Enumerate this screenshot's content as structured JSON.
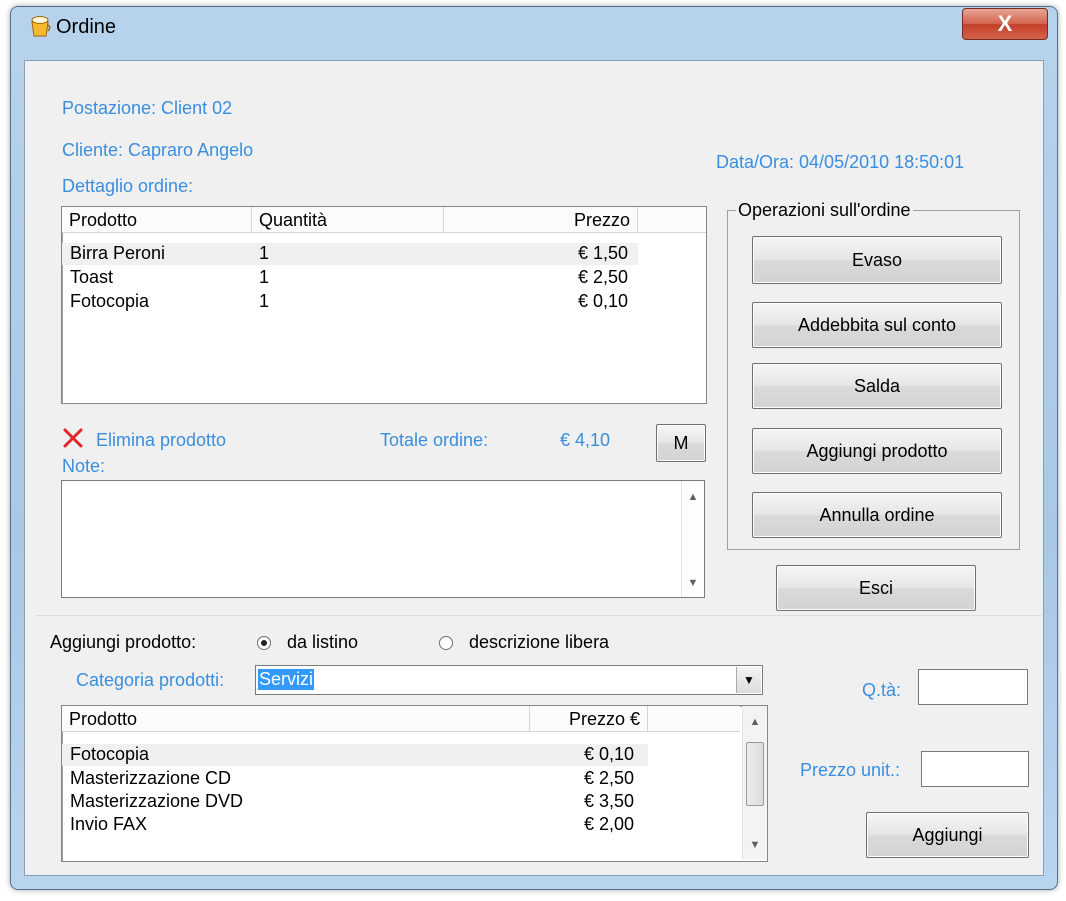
{
  "window": {
    "title": "Ordine",
    "close_glyph": "X"
  },
  "info": {
    "postazione": "Postazione: Client 02",
    "cliente": "Cliente: Capraro Angelo",
    "dettaglio": "Dettaglio ordine:",
    "data_ora": "Data/Ora: 04/05/2010 18:50:01"
  },
  "order_list": {
    "columns": [
      "Prodotto",
      "Quantità",
      "Prezzo"
    ],
    "rows": [
      {
        "product": "Birra Peroni",
        "qty": "1",
        "price": "€ 1,50"
      },
      {
        "product": "Toast",
        "qty": "1",
        "price": "€ 2,50"
      },
      {
        "product": "Fotocopia",
        "qty": "1",
        "price": "€ 0,10"
      }
    ]
  },
  "delete_label": "Elimina prodotto",
  "totale_label": "Totale ordine:",
  "totale_value": "€ 4,10",
  "m_button": "M",
  "note_label": "Note:",
  "note_value": "",
  "operations": {
    "legend": "Operazioni sull'ordine",
    "buttons": [
      "Evaso",
      "Addebbita sul conto",
      "Salda",
      "Aggiungi prodotto",
      "Annulla ordine"
    ]
  },
  "esci_button": "Esci",
  "add_product": {
    "label": "Aggiungi prodotto:",
    "option_listino": "da listino",
    "option_libera": "descrizione libera",
    "selected": "da listino",
    "categoria_label": "Categoria prodotti:",
    "categoria_value": "Servizi",
    "qta_label": "Q.tà:",
    "qta_value": "",
    "prezzo_label": "Prezzo unit.:",
    "prezzo_value": "",
    "aggiungi_button": "Aggiungi"
  },
  "catalog_list": {
    "columns": [
      "Prodotto",
      "Prezzo €"
    ],
    "rows": [
      {
        "product": "Fotocopia",
        "price": "€ 0,10"
      },
      {
        "product": "Masterizzazione CD",
        "price": "€ 2,50"
      },
      {
        "product": "Masterizzazione DVD",
        "price": "€ 3,50"
      },
      {
        "product": "Invio FAX",
        "price": "€ 2,00"
      }
    ]
  },
  "colors": {
    "accent_blue": "#3a8ee0",
    "close_red": "#c2402a",
    "delete_x": "#e0262a"
  }
}
